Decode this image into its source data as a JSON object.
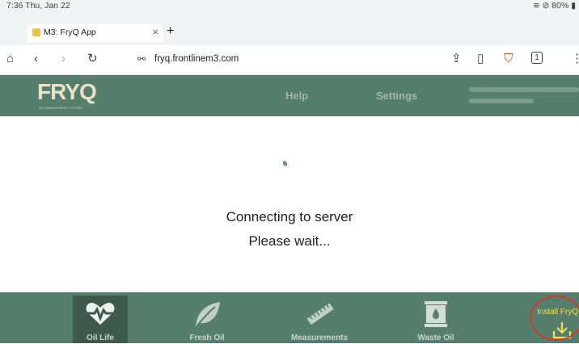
{
  "status_bar": {
    "time": "7:36  Thu, Jan 22",
    "battery": "80%"
  },
  "tab": {
    "title": "M3: FryQ App",
    "close": "×"
  },
  "new_tab": "+",
  "address_bar": {
    "url": "fryq.frontlinem3.com",
    "tab_count": "1"
  },
  "app_header": {
    "logo_text": "FRYQ",
    "logo_subtitle": "OIL MANAGEMENT SYSTEM",
    "nav": [
      "Help",
      "Settings"
    ]
  },
  "main": {
    "line1": "Connecting to server",
    "line2": "Please wait..."
  },
  "bottom_nav": {
    "items": [
      {
        "label": "Oil Life",
        "icon": "heartbeat-icon",
        "active": true
      },
      {
        "label": "Fresh Oil",
        "icon": "leaf-icon",
        "active": false
      },
      {
        "label": "Measurements",
        "icon": "ruler-icon",
        "active": false
      },
      {
        "label": "Waste Oil",
        "icon": "oil-barrel-icon",
        "active": false
      }
    ],
    "install_label": "Install FryQ"
  },
  "colors": {
    "header": "#557e6d",
    "active_nav": "#3d5a4d",
    "install_text": "#f1e04f",
    "annotation_circle": "#d23a2c"
  }
}
